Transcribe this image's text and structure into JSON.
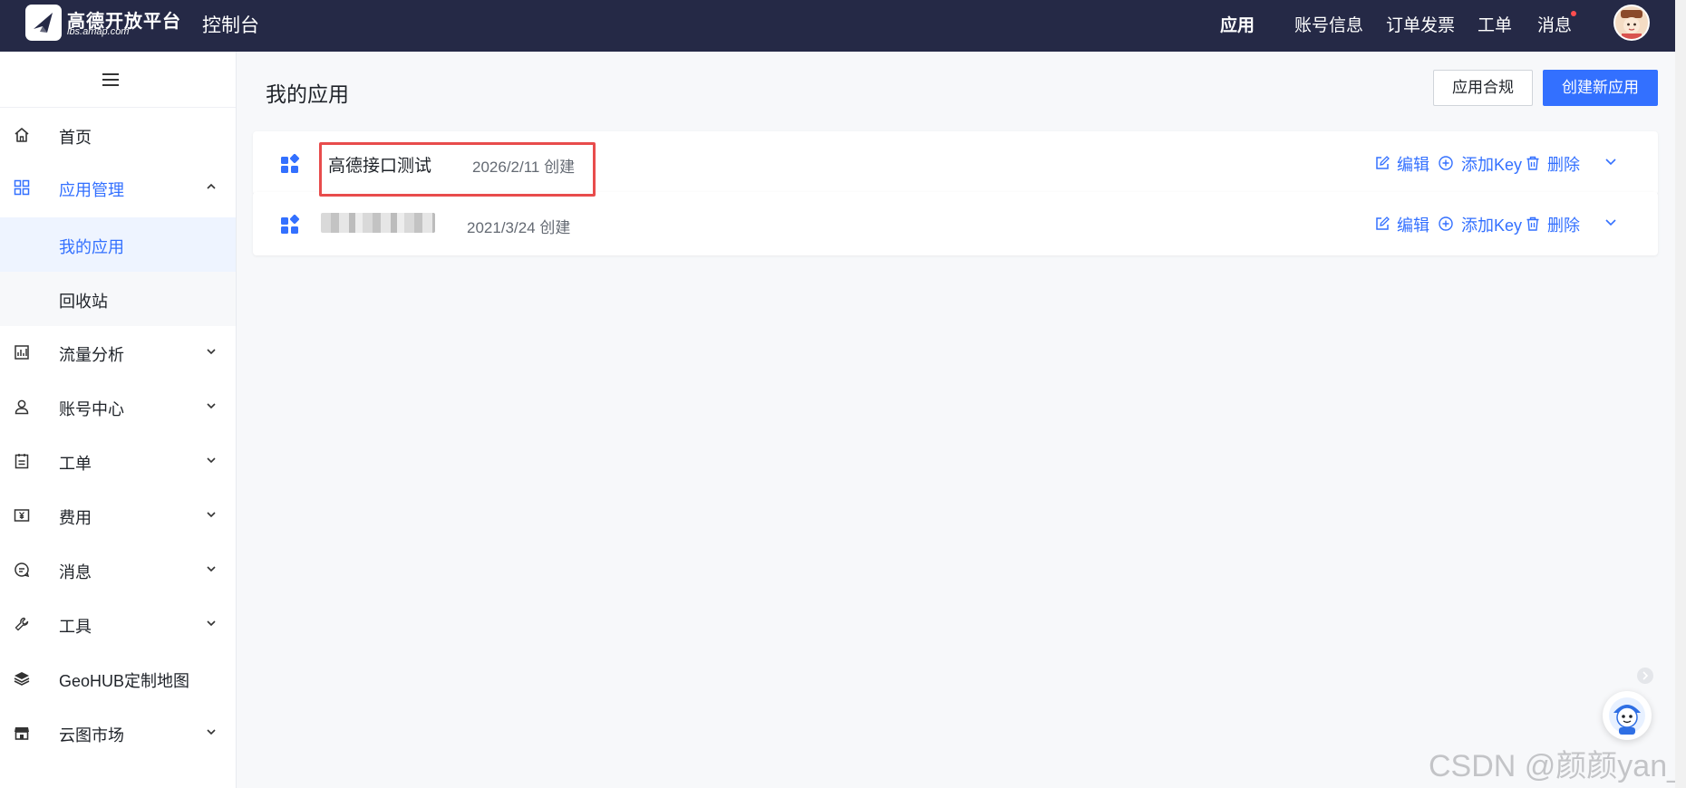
{
  "header": {
    "logo_name": "高德开放平台",
    "logo_url": "lbs.amap.com",
    "console_label": "控制台",
    "nav": [
      "应用",
      "账号信息",
      "订单发票",
      "工单",
      "消息"
    ]
  },
  "sidebar": {
    "items": [
      {
        "label": "首页",
        "icon": "home-icon"
      },
      {
        "label": "应用管理",
        "icon": "grid-icon",
        "expanded": true
      },
      {
        "label": "我的应用",
        "sub": true,
        "active": true
      },
      {
        "label": "回收站",
        "sub": true
      },
      {
        "label": "流量分析",
        "icon": "chart-icon"
      },
      {
        "label": "账号中心",
        "icon": "user-icon"
      },
      {
        "label": "工单",
        "icon": "ticket-icon"
      },
      {
        "label": "费用",
        "icon": "yen-icon"
      },
      {
        "label": "消息",
        "icon": "message-icon"
      },
      {
        "label": "工具",
        "icon": "wrench-icon"
      },
      {
        "label": "GeoHUB定制地图",
        "icon": "layers-icon"
      },
      {
        "label": "云图市场",
        "icon": "store-icon"
      }
    ]
  },
  "main": {
    "title": "我的应用",
    "compliance_button": "应用合规",
    "create_button": "创建新应用",
    "apps": [
      {
        "name": "高德接口测试",
        "date": "2026/2/11 创建"
      },
      {
        "name": "",
        "date": "2021/3/24 创建"
      }
    ],
    "actions": {
      "edit": "编辑",
      "add_key": "添加Key",
      "delete": "删除"
    }
  },
  "watermark": "CSDN @颜颜yan_",
  "colors": {
    "topbar": "#252946",
    "accent": "#3370ff",
    "highlight": "#e84c4c"
  }
}
